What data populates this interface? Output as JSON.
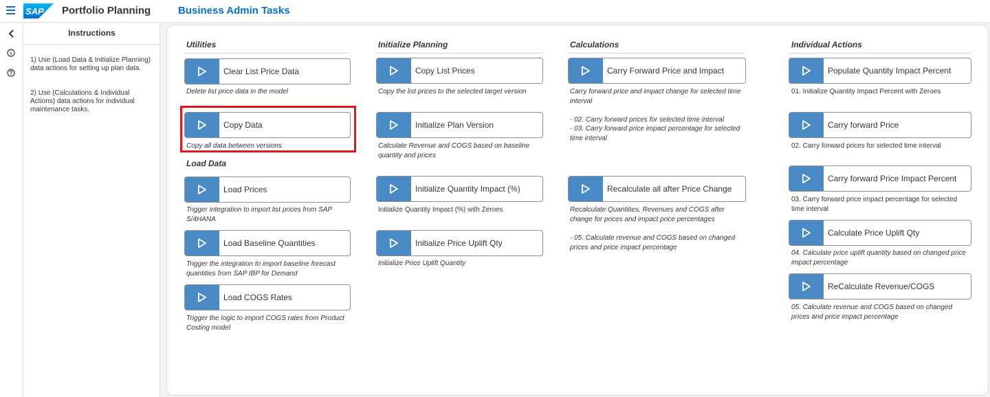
{
  "header": {
    "app_title": "Portfolio Planning",
    "page_heading": "Business Admin Tasks",
    "logo_text": "SAP"
  },
  "rail": {
    "icons": [
      "back-arrow-icon",
      "info-icon",
      "help-icon"
    ]
  },
  "instructions": {
    "title": "Instructions",
    "items": [
      "1) Use (Load Data & Initialize Planning) data actions for setting up plan data.",
      "2) Use (Calculations & Individual Actions) data actions for individual maintenance tasks."
    ]
  },
  "sections": {
    "utilities": "Utilities",
    "initialize_planning": "Initialize Planning",
    "calculations": "Calculations",
    "individual_actions": "Individual Actions",
    "load_data": "Load Data"
  },
  "actions": {
    "clear_list_price": {
      "label": "Clear List Price Data",
      "desc": "Delete list price data in the model"
    },
    "copy_data": {
      "label": "Copy Data",
      "desc": "Copy all data between versions"
    },
    "load_prices": {
      "label": "Load Prices",
      "desc": "Trigger integration to import list prices from SAP S/4HANA"
    },
    "load_baseline": {
      "label": "Load Baseline Quantities",
      "desc": "Trigger the integration to import baseline forecast quantities from SAP IBP for Demand"
    },
    "load_cogs": {
      "label": "Load COGS Rates",
      "desc": "Trigger the logic to import COGS rates from Product Costing model"
    },
    "copy_list_prices": {
      "label": "Copy List Prices",
      "desc": "Copy the list prices to the selected target version"
    },
    "init_plan_version": {
      "label": "Initialize Plan Version",
      "desc": "Calculate Revenue and COGS based on baseline quantity and prices"
    },
    "init_qty_impact": {
      "label": "Initialize Quantity Impact (%)",
      "desc": "Initialize Quantity Impact (%) with Zeroes"
    },
    "init_price_uplift": {
      "label": "Initialize Price Uplift Qty",
      "desc": "Initialize Price Uplift Quantity"
    },
    "carry_forward_price_impact": {
      "label": "Carry Forward Price and Impact",
      "desc": "Carry forward price and impact change for selected time interval",
      "desc_line2": "- 02. Carry forward prices for selected time interval",
      "desc_line3": "- 03. Carry forward price impact percentage for selected time interval"
    },
    "recalc_after_price": {
      "label": "Recalculate all after Price Change",
      "desc": "Recalculate Quantities, Revenues and COGS after change for prices and impact price percentages",
      "desc_line2": "- 05. Calculate revenue and COGS based on changed prices and price impact percentage"
    },
    "populate_qty_impact": {
      "label": "Populate Quantity Impact Percent",
      "desc": "01. Initialize Quantity Impact Percent with Zeroes"
    },
    "carry_forward_price": {
      "label": "Carry forward Price",
      "desc": "02. Carry forward prices for selected time interval"
    },
    "carry_forward_impact_pct": {
      "label": "Carry forward Price Impact Percent",
      "desc": "03. Carry forward price impact percentage for selected time interval"
    },
    "calc_price_uplift": {
      "label": "Calculate Price Uplift Qty",
      "desc": "04. Calculate price uplift quantity based on changed price impact percentage"
    },
    "recalc_revenue_cogs": {
      "label": "ReCalculate Revenue/COGS",
      "desc": "05. Calculate revenue and COGS based on changed prices and price impact percentage"
    }
  },
  "colors": {
    "accent": "#0a6ed1",
    "play_button": "#4a8bc6",
    "highlight": "#e8141b"
  }
}
